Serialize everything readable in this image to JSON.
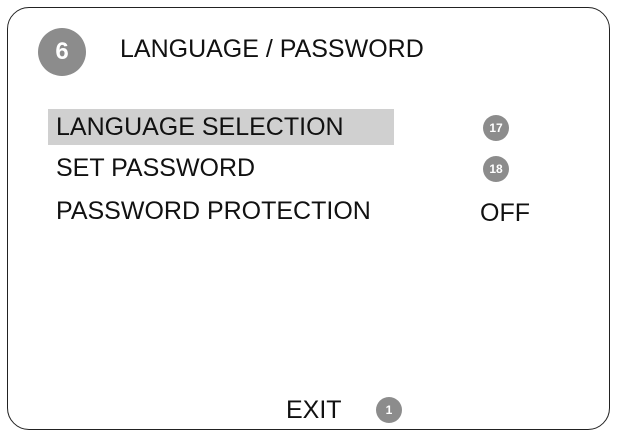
{
  "header": {
    "menu_number": "6",
    "title": "LANGUAGE / PASSWORD"
  },
  "menu": {
    "items": [
      {
        "label": "LANGUAGE SELECTION",
        "badge": "17",
        "selected": true
      },
      {
        "label": "SET PASSWORD",
        "badge": "18",
        "selected": false
      },
      {
        "label": "PASSWORD PROTECTION",
        "value": "OFF",
        "selected": false
      }
    ]
  },
  "footer": {
    "exit_label": "EXIT",
    "exit_badge": "1"
  },
  "colors": {
    "highlight": "#d0d0d0",
    "badge": "#8c8c8c",
    "text": "#111111",
    "border": "#222222"
  }
}
